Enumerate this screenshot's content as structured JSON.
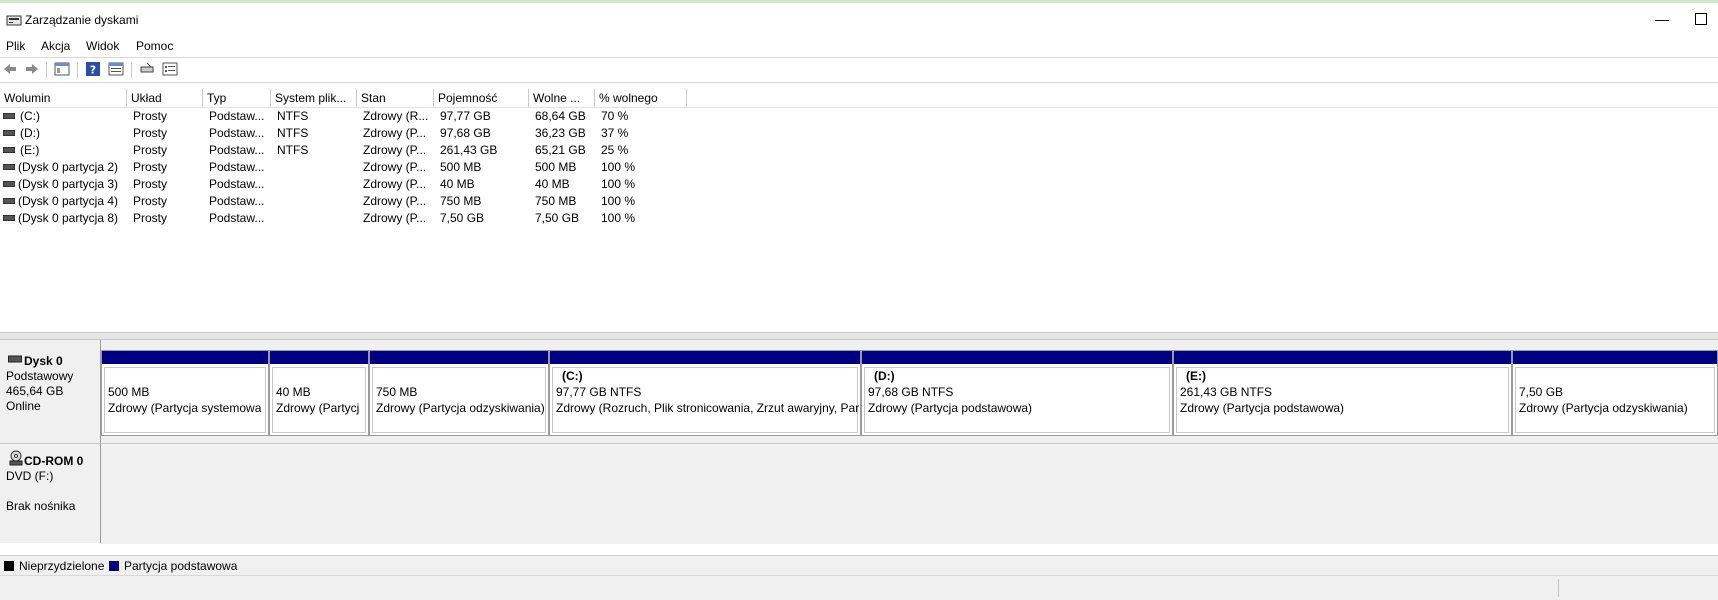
{
  "window": {
    "title": "Zarządzanie dyskami"
  },
  "menu": [
    "Plik",
    "Akcja",
    "Widok",
    "Pomoc"
  ],
  "toolbar": [
    "back-icon",
    "forward-icon",
    "console-tree-icon",
    "help-icon",
    "properties-icon",
    "connect-icon",
    "list-icon"
  ],
  "volume_table": {
    "columns": [
      "Wolumin",
      "Układ",
      "Typ",
      "System plik...",
      "Stan",
      "Pojemność",
      "Wolne ...",
      "% wolnego"
    ],
    "rows": [
      [
        "(C:)",
        "Prosty",
        "Podstaw...",
        "NTFS",
        "Zdrowy (R...",
        "97,77 GB",
        "68,64 GB",
        "70 %"
      ],
      [
        "(D:)",
        "Prosty",
        "Podstaw...",
        "NTFS",
        "Zdrowy (P...",
        "97,68 GB",
        "36,23 GB",
        "37 %"
      ],
      [
        "(E:)",
        "Prosty",
        "Podstaw...",
        "NTFS",
        "Zdrowy (P...",
        "261,43 GB",
        "65,21 GB",
        "25 %"
      ],
      [
        "(Dysk 0 partycja 2)",
        "Prosty",
        "Podstaw...",
        "",
        "Zdrowy (P...",
        "500 MB",
        "500 MB",
        "100 %"
      ],
      [
        "(Dysk 0 partycja 3)",
        "Prosty",
        "Podstaw...",
        "",
        "Zdrowy (P...",
        "40 MB",
        "40 MB",
        "100 %"
      ],
      [
        "(Dysk 0 partycja 4)",
        "Prosty",
        "Podstaw...",
        "",
        "Zdrowy (P...",
        "750 MB",
        "750 MB",
        "100 %"
      ],
      [
        "(Dysk 0 partycja 8)",
        "Prosty",
        "Podstaw...",
        "",
        "Zdrowy (P...",
        "7,50 GB",
        "7,50 GB",
        "100 %"
      ]
    ]
  },
  "disk0": {
    "name": "Dysk 0",
    "type": "Podstawowy",
    "size": "465,64 GB",
    "status": "Online",
    "partitions": [
      {
        "letter": "",
        "size": "500 MB",
        "status": "Zdrowy (Partycja systemowa"
      },
      {
        "letter": "",
        "size": "40 MB",
        "status": "Zdrowy (Partycj"
      },
      {
        "letter": "",
        "size": "750 MB",
        "status": "Zdrowy (Partycja odzyskiwania)"
      },
      {
        "letter": "(C:)",
        "size": "97,77 GB NTFS",
        "status": "Zdrowy (Rozruch, Plik stronicowania, Zrzut awaryjny, Par"
      },
      {
        "letter": "(D:)",
        "size": "97,68 GB NTFS",
        "status": "Zdrowy (Partycja podstawowa)"
      },
      {
        "letter": "(E:)",
        "size": "261,43 GB NTFS",
        "status": "Zdrowy (Partycja podstawowa)"
      },
      {
        "letter": "",
        "size": "7,50 GB",
        "status": "Zdrowy (Partycja odzyskiwania)"
      }
    ]
  },
  "cdrom0": {
    "name": "CD-ROM 0",
    "drive": "DVD (F:)",
    "media": "Brak nośnika"
  },
  "legend": [
    {
      "label": "Nieprzydzielone",
      "color": "#000000"
    },
    {
      "label": "Partycja podstawowa",
      "color": "#000080"
    }
  ]
}
